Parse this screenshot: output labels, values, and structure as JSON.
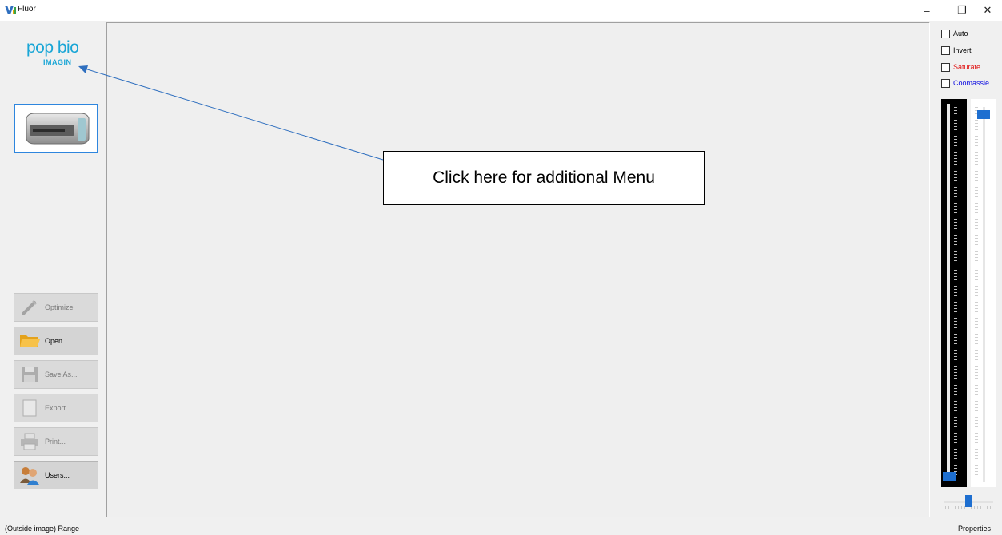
{
  "window": {
    "title": "Fluor",
    "minimize_glyph": "–",
    "restore_glyph": "❐",
    "close_glyph": "✕"
  },
  "logo": {
    "line1": "pop bio",
    "line2": "IMAGIN"
  },
  "sidebar": {
    "buttons": [
      {
        "label": "Optimize",
        "icon": "wand-icon",
        "enabled": false
      },
      {
        "label": "Open...",
        "icon": "folder-icon",
        "enabled": true
      },
      {
        "label": "Save As...",
        "icon": "floppy-disk-icon",
        "enabled": false
      },
      {
        "label": "Export...",
        "icon": "export-icon",
        "enabled": false
      },
      {
        "label": "Print...",
        "icon": "printer-icon",
        "enabled": false
      },
      {
        "label": "Users...",
        "icon": "users-icon",
        "enabled": true
      }
    ]
  },
  "callout": {
    "text": "Click here for additional Menu"
  },
  "options": {
    "auto": {
      "label": "Auto",
      "checked": false,
      "color": "#000000"
    },
    "invert": {
      "label": "Invert",
      "checked": false,
      "color": "#000000"
    },
    "saturate": {
      "label": "Saturate",
      "checked": false,
      "color": "#e01010"
    },
    "coomassie": {
      "label": "Coomassie",
      "checked": false,
      "color": "#1010e0"
    }
  },
  "status": {
    "left": "(Outside image)  Range",
    "right": "Properties"
  },
  "colors": {
    "accent": "#1e6fd0",
    "logo": "#1aa6d6"
  }
}
